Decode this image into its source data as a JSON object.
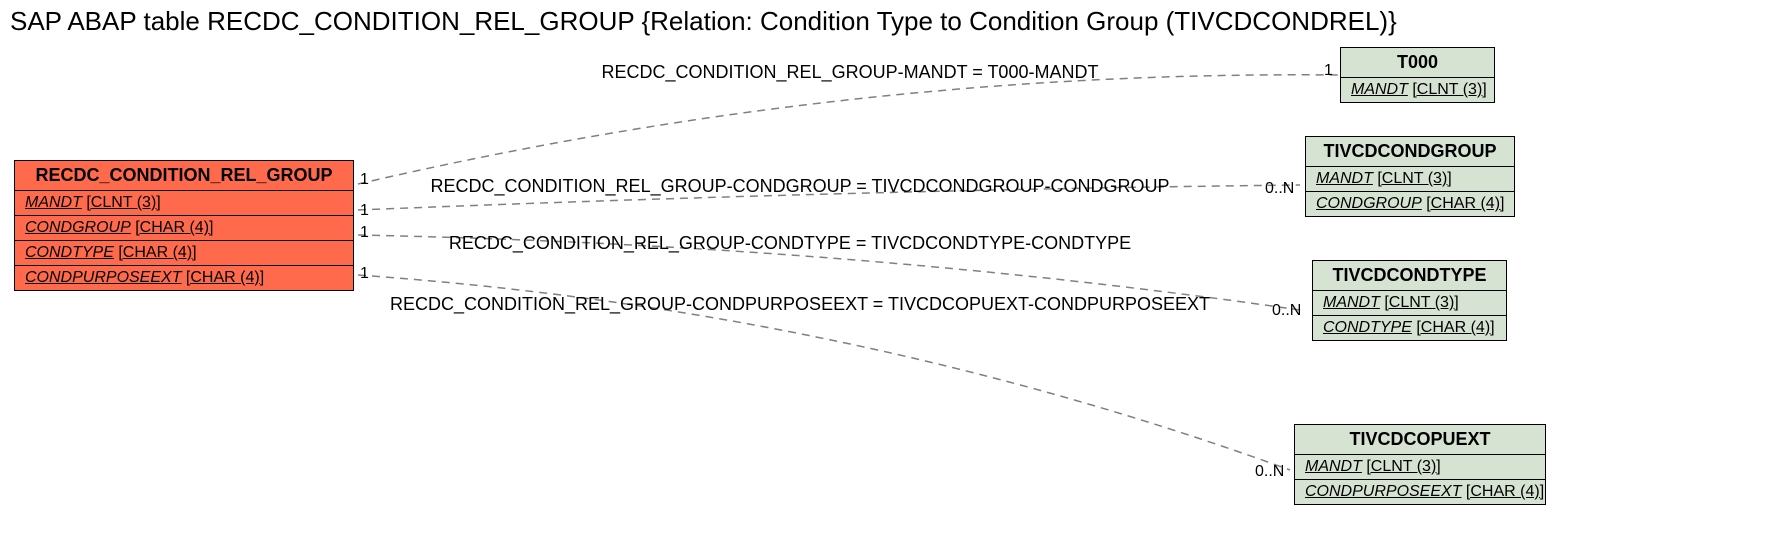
{
  "title": "SAP ABAP table RECDC_CONDITION_REL_GROUP {Relation: Condition Type to Condition Group (TIVCDCONDREL)}",
  "main_entity": {
    "name": "RECDC_CONDITION_REL_GROUP",
    "fields": [
      {
        "name": "MANDT",
        "type": "[CLNT (3)]"
      },
      {
        "name": "CONDGROUP",
        "type": "[CHAR (4)]"
      },
      {
        "name": "CONDTYPE",
        "type": "[CHAR (4)]"
      },
      {
        "name": "CONDPURPOSEEXT",
        "type": "[CHAR (4)]"
      }
    ]
  },
  "related_entities": [
    {
      "name": "T000",
      "fields": [
        {
          "name": "MANDT",
          "type": "[CLNT (3)]"
        }
      ]
    },
    {
      "name": "TIVCDCONDGROUP",
      "fields": [
        {
          "name": "MANDT",
          "type": "[CLNT (3)]"
        },
        {
          "name": "CONDGROUP",
          "type": "[CHAR (4)]"
        }
      ]
    },
    {
      "name": "TIVCDCONDTYPE",
      "fields": [
        {
          "name": "MANDT",
          "type": "[CLNT (3)]"
        },
        {
          "name": "CONDTYPE",
          "type": "[CHAR (4)]"
        }
      ]
    },
    {
      "name": "TIVCDCOPUEXT",
      "fields": [
        {
          "name": "MANDT",
          "type": "[CLNT (3)]"
        },
        {
          "name": "CONDPURPOSEEXT",
          "type": "[CHAR (4)]"
        }
      ]
    }
  ],
  "relations": [
    {
      "label": "RECDC_CONDITION_REL_GROUP-MANDT = T000-MANDT",
      "left_card": "1",
      "right_card": "1"
    },
    {
      "label": "RECDC_CONDITION_REL_GROUP-CONDGROUP = TIVCDCONDGROUP-CONDGROUP",
      "left_card": "1",
      "right_card": "0..N"
    },
    {
      "label": "RECDC_CONDITION_REL_GROUP-CONDTYPE = TIVCDCONDTYPE-CONDTYPE",
      "left_card": "1",
      "right_card": "0..N"
    },
    {
      "label": "RECDC_CONDITION_REL_GROUP-CONDPURPOSEEXT = TIVCDCOPUEXT-CONDPURPOSEEXT",
      "left_card": "1",
      "right_card": "0..N"
    }
  ]
}
